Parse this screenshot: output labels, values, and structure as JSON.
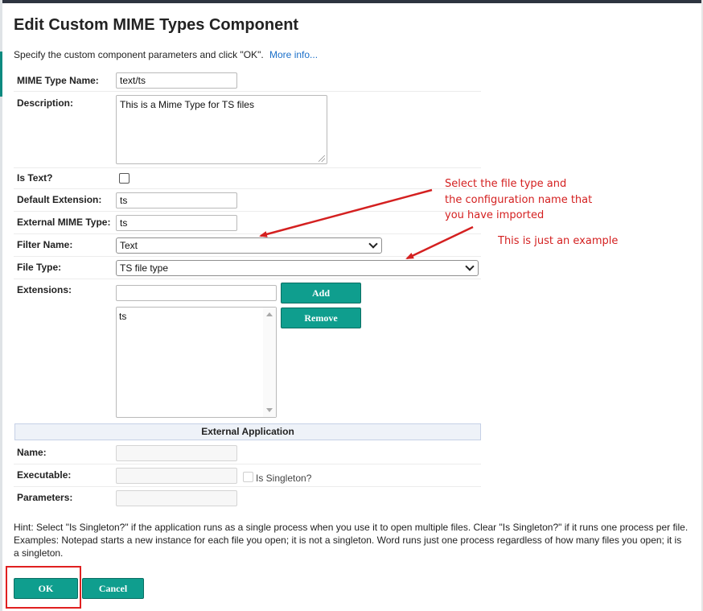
{
  "dialog": {
    "title": "Edit Custom MIME Types Component",
    "subtitle": "Specify the custom component parameters and click \"OK\".",
    "more_info": "More info..."
  },
  "form": {
    "mime_type_name": {
      "label": "MIME Type Name:",
      "value": "text/ts"
    },
    "description": {
      "label": "Description:",
      "value": "This is a Mime Type for TS files"
    },
    "is_text": {
      "label": "Is Text?",
      "checked": false
    },
    "default_extension": {
      "label": "Default Extension:",
      "value": "ts"
    },
    "external_mime_type": {
      "label": "External MIME Type:",
      "value": "ts"
    },
    "filter_name": {
      "label": "Filter Name:",
      "selected": "Text"
    },
    "file_type": {
      "label": "File Type:",
      "selected": "TS file type"
    },
    "extensions": {
      "label": "Extensions:",
      "input_value": "",
      "add_label": "Add",
      "remove_label": "Remove",
      "items": [
        "ts"
      ]
    }
  },
  "external_application": {
    "header": "External Application",
    "name": {
      "label": "Name:",
      "value": ""
    },
    "executable": {
      "label": "Executable:",
      "value": ""
    },
    "is_singleton": {
      "label": "Is Singleton?",
      "checked": false
    },
    "parameters": {
      "label": "Parameters:",
      "value": ""
    }
  },
  "hint": "Hint: Select \"Is Singleton?\" if the application runs as a single process when you use it to open multiple files. Clear \"Is Singleton?\" if it runs one process per file. Examples: Notepad starts a new instance for each file you open; it is not a singleton. Word runs just one process regardless of how many files you open; it is a singleton.",
  "buttons": {
    "ok": "OK",
    "cancel": "Cancel"
  },
  "annotations": {
    "note_line1": "Select the file type and",
    "note_line2": "the configuration name that",
    "note_line3": "you have imported",
    "example": "This is just an example"
  },
  "colors": {
    "accent": "#0f9e8e",
    "annotation": "#d42020",
    "link": "#1a6fc9"
  }
}
